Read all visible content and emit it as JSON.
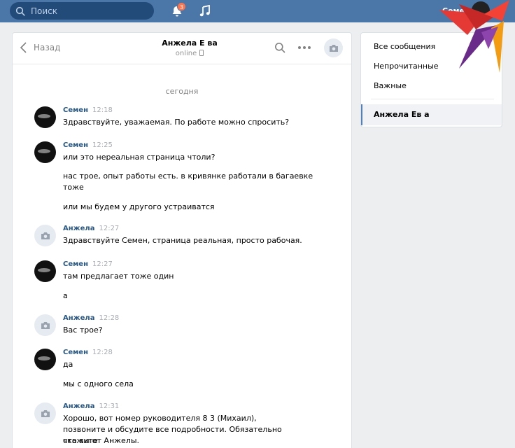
{
  "topbar": {
    "search_placeholder": "Поиск",
    "notifications_count": "3",
    "user_name": "Семен"
  },
  "chat": {
    "back_label": "Назад",
    "contact_name": "Анжела Е                ва",
    "contact_status": "online",
    "date_separator": "сегодня",
    "messages": [
      {
        "author": "Семен",
        "time": "12:18",
        "lines": [
          "Здравствуйте, уважаемая. По работе можно спросить?"
        ]
      },
      {
        "author": "Семен",
        "time": "12:25",
        "lines": [
          "или это нереальная страница чтоли?",
          "нас трое, опыт работы есть. в кривянке работали в багаевке",
          "тоже",
          "или мы будем у другого устраиватся"
        ]
      },
      {
        "author": "Анжела",
        "time": "12:27",
        "lines": [
          "Здравствуйте Семен, страница реальная, просто рабочая."
        ]
      },
      {
        "author": "Семен",
        "time": "12:27",
        "lines": [
          "там предлагает тоже один",
          "а"
        ]
      },
      {
        "author": "Анжела",
        "time": "12:28",
        "lines": [
          "Вас трое?"
        ]
      },
      {
        "author": "Семен",
        "time": "12:28",
        "lines": [
          "да",
          "мы с одного села"
        ]
      },
      {
        "author": "Анжела",
        "time": "12:31",
        "lines": [
          "Хорошо, вот номер руководителя 8          3      (Михаил),",
          "позвоните и обсудите все подробности. Обязательно скажите",
          "что вы от Анжелы."
        ]
      }
    ]
  },
  "sidebar": {
    "items": [
      "Все сообщения",
      "Непрочитанные",
      "Важные"
    ],
    "active_dialog": "Анжела Ев              а"
  },
  "colors": {
    "topbar": "#4a76a8",
    "author": "#2a5885",
    "badge": "#ff734c"
  }
}
